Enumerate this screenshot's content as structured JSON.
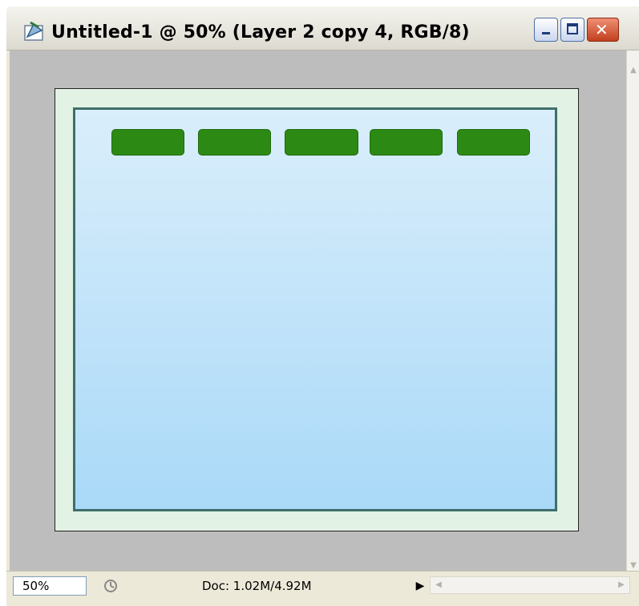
{
  "window": {
    "title": "Untitled-1 @ 50% (Layer 2 copy 4, RGB/8)",
    "icons": [
      "photoshop-document-icon",
      "minimize-icon",
      "maximize-icon",
      "close-icon"
    ]
  },
  "canvas": {
    "colors": {
      "pasteboard": "#bdbdbd",
      "outer_frame": "#e2f2e4",
      "inner_border": "#3e6f6b",
      "gradient_top": "#daeefb",
      "gradient_bottom": "#a9d9f8",
      "block": "#2c8a14"
    },
    "block_count": 5
  },
  "statusbar": {
    "zoom": "50%",
    "doc_info": "Doc: 1.02M/4.92M",
    "icons": [
      "status-icon",
      "status-menu-arrow-icon",
      "scroll-left-icon",
      "scroll-right-icon"
    ]
  }
}
